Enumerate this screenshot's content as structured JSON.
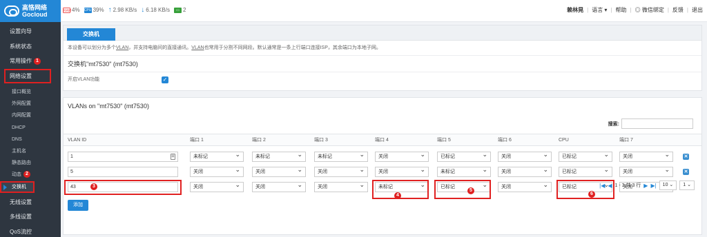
{
  "brand": {
    "cn": "高恪网络",
    "en": "Gocloud"
  },
  "stats": {
    "ram": "4%",
    "cpu": "39%",
    "upload": "2.98 KB/s",
    "download": "6.18 KB/s",
    "screens": "2"
  },
  "topnav": {
    "user": "赖林晃",
    "language": "语言",
    "help": "帮助",
    "wechat": "微信绑定",
    "feedback": "反馈",
    "logout": "退出"
  },
  "sidebar": {
    "items": [
      {
        "label": "设置向导"
      },
      {
        "label": "系统状态"
      },
      {
        "label": "常用操作",
        "badge": "1"
      },
      {
        "label": "网络设置"
      }
    ],
    "sub": [
      {
        "label": "接口概览"
      },
      {
        "label": "外网配置"
      },
      {
        "label": "内网配置"
      },
      {
        "label": "DHCP"
      },
      {
        "label": "DNS"
      },
      {
        "label": "主机名"
      },
      {
        "label": "静态路由"
      },
      {
        "label": "动态",
        "badge": "2"
      },
      {
        "label": "交换机"
      }
    ],
    "bottom": [
      {
        "label": "无线设置"
      },
      {
        "label": "多线设置"
      },
      {
        "label": "QoS流控"
      }
    ]
  },
  "tab": {
    "label": "交换机"
  },
  "description": {
    "pre": "本设备可以划分为多个",
    "vlan1": "VLAN",
    "mid": "，并支持电脑间的直接通讯。",
    "vlan2": "VLAN",
    "post": "也常用于分割不同网段。默认通常是一条上行端口连接ISP，其余端口为本地子网。"
  },
  "switch_section": {
    "title": "交换机\"mt7530\" (mt7530)",
    "enable_label": "开启VLAN功能"
  },
  "vlans_section": {
    "title": "VLANs on \"mt7530\" (mt7530)",
    "search_label": "搜索:"
  },
  "table": {
    "headers": [
      "VLAN ID",
      "端口 1",
      "端口 2",
      "端口 3",
      "端口 4",
      "端口 5",
      "端口 6",
      "CPU",
      "端口 7"
    ],
    "rows": [
      {
        "id": "1",
        "ports": [
          "未标记",
          "未标记",
          "未标记",
          "关闭",
          "已标记",
          "关闭",
          "已标记",
          "关闭"
        ]
      },
      {
        "id": "5",
        "ports": [
          "关闭",
          "关闭",
          "关闭",
          "关闭",
          "未标记",
          "关闭",
          "已标记",
          "关闭"
        ]
      },
      {
        "id": "43",
        "ports": [
          "关闭",
          "关闭",
          "关闭",
          "未标记",
          "已标记",
          "关闭",
          "已标记",
          "关闭"
        ]
      }
    ]
  },
  "annotations": {
    "b3": "3",
    "b4": "4",
    "b5": "5",
    "b6": "6"
  },
  "pager": {
    "info": "1 - 3 共 3 行",
    "page_size": "10",
    "page": "1"
  },
  "add_button": "添加",
  "colors": {
    "accent": "#2387d6",
    "sidebar": "#2e3640",
    "highlight": "#e02020"
  }
}
